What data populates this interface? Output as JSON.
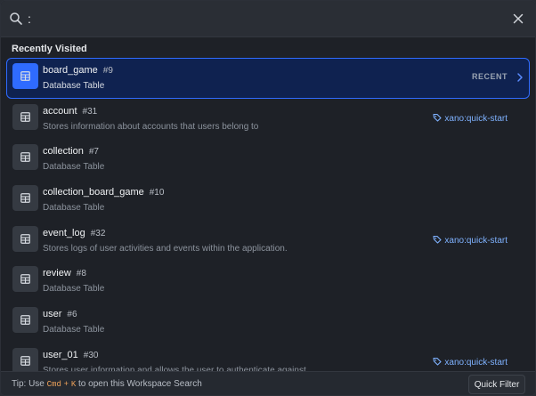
{
  "search": {
    "value": ":",
    "placeholder": ""
  },
  "section_title": "Recently Visited",
  "items": [
    {
      "name": "board_game",
      "id": "#9",
      "description": "Database Table",
      "badge": "RECENT",
      "tag": ""
    },
    {
      "name": "account",
      "id": "#31",
      "description": "Stores information about accounts that users belong to",
      "badge": "",
      "tag": "xano:quick-start"
    },
    {
      "name": "collection",
      "id": "#7",
      "description": "Database Table",
      "badge": "",
      "tag": ""
    },
    {
      "name": "collection_board_game",
      "id": "#10",
      "description": "Database Table",
      "badge": "",
      "tag": ""
    },
    {
      "name": "event_log",
      "id": "#32",
      "description": "Stores logs of user activities and events within the application.",
      "badge": "",
      "tag": "xano:quick-start"
    },
    {
      "name": "review",
      "id": "#8",
      "description": "Database Table",
      "badge": "",
      "tag": ""
    },
    {
      "name": "user",
      "id": "#6",
      "description": "Database Table",
      "badge": "",
      "tag": ""
    },
    {
      "name": "user_01",
      "id": "#30",
      "description": "Stores user information and allows the user to authenticate against",
      "badge": "",
      "tag": "xano:quick-start"
    }
  ],
  "footer": {
    "tip_prefix": "Tip: Use",
    "key1": "Cmd",
    "plus": "+",
    "key2": "K",
    "tip_suffix": "to open this Workspace Search",
    "quick_filter_label": "Quick Filter"
  },
  "colors": {
    "accent": "#2f6bff",
    "selected_bg": "#0f2250",
    "tag": "#7fb2ff",
    "kbd": "#f0a35a"
  }
}
